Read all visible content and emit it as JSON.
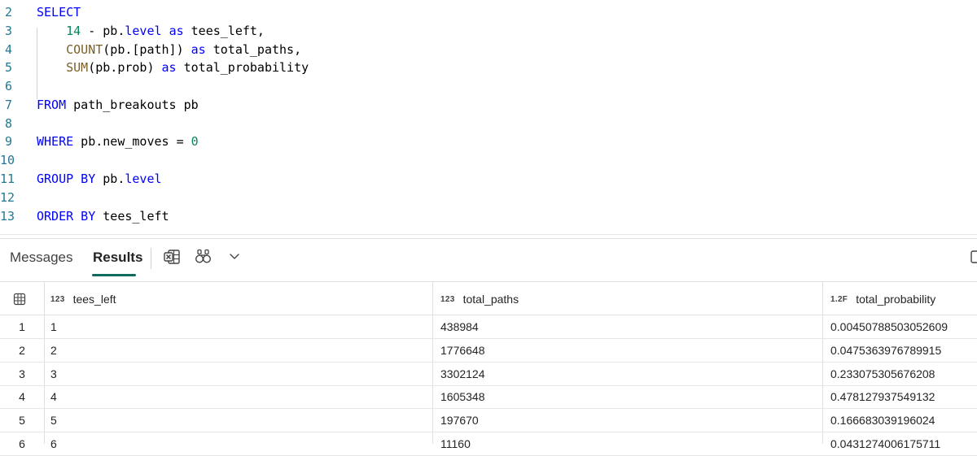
{
  "editor": {
    "lines": [
      {
        "num": "2",
        "code": "SELECT"
      },
      {
        "num": "3",
        "code": "    14 - pb.level as tees_left,"
      },
      {
        "num": "4",
        "code": "    COUNT(pb.[path]) as total_paths,"
      },
      {
        "num": "5",
        "code": "    SUM(pb.prob) as total_probability"
      },
      {
        "num": "6",
        "code": ""
      },
      {
        "num": "7",
        "code": "FROM path_breakouts pb"
      },
      {
        "num": "8",
        "code": ""
      },
      {
        "num": "9",
        "code": "WHERE pb.new_moves = 0"
      },
      {
        "num": "10",
        "code": ""
      },
      {
        "num": "11",
        "code": "GROUP BY pb.level"
      },
      {
        "num": "12",
        "code": ""
      },
      {
        "num": "13",
        "code": "ORDER BY tees_left"
      }
    ]
  },
  "results_toolbar": {
    "tabs": [
      {
        "label": "Messages",
        "active": false
      },
      {
        "label": "Results",
        "active": true
      }
    ],
    "icons": [
      "excel-icon",
      "find-icon",
      "chevron-down-icon",
      "copy-icon"
    ]
  },
  "grid": {
    "columns": [
      {
        "type": "123",
        "name": "tees_left"
      },
      {
        "type": "123",
        "name": "total_paths"
      },
      {
        "type": "1.2F",
        "name": "total_probability"
      }
    ],
    "rows": [
      {
        "n": "1",
        "cells": [
          "1",
          "438984",
          "0.00450788503052609"
        ]
      },
      {
        "n": "2",
        "cells": [
          "2",
          "1776648",
          "0.0475363976789915"
        ]
      },
      {
        "n": "3",
        "cells": [
          "3",
          "3302124",
          "0.233075305676208"
        ]
      },
      {
        "n": "4",
        "cells": [
          "4",
          "1605348",
          "0.478127937549132"
        ]
      },
      {
        "n": "5",
        "cells": [
          "5",
          "197670",
          "0.166683039196024"
        ]
      },
      {
        "n": "6",
        "cells": [
          "6",
          "11160",
          "0.0431274006175711"
        ]
      }
    ]
  },
  "colors": {
    "keyword": "#0000ff",
    "function": "#795e26",
    "number": "#098658",
    "line_number": "#237893",
    "tab_accent": "#0f6b5f"
  }
}
